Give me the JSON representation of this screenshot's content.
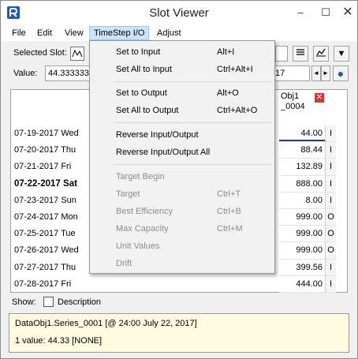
{
  "window": {
    "title": "Slot Viewer",
    "minimize": "–",
    "maximize": "☐",
    "close": "✕"
  },
  "menubar": {
    "items": [
      "File",
      "Edit",
      "View",
      "TimeStep I/O",
      "Adjust"
    ],
    "active_index": 3
  },
  "toolbar": {
    "selected_slot_label": "Selected Slot:",
    "value_label": "Value:",
    "value": "44.333333",
    "date_field": "17",
    "btn_prev": "◄",
    "btn_next": "►",
    "dropdown_arrow": "▼",
    "globe": "●"
  },
  "table": {
    "column_header_line1": "Obj1",
    "column_header_line2": "_0004",
    "close_x": "✕",
    "rows": [
      {
        "date": "07-19-2017 Wed",
        "value": "44.00",
        "flag": "I",
        "bold": false
      },
      {
        "date": "07-20-2017 Thu",
        "value": "88.44",
        "flag": "I",
        "bold": false
      },
      {
        "date": "07-21-2017 Fri",
        "value": "132.89",
        "flag": "I",
        "bold": false
      },
      {
        "date": "07-22-2017 Sat",
        "value": "888.00",
        "flag": "I",
        "bold": true
      },
      {
        "date": "07-23-2017 Sun",
        "value": "8.00",
        "flag": "I",
        "bold": false
      },
      {
        "date": "07-24-2017 Mon",
        "value": "999.00",
        "flag": "O",
        "bold": false
      },
      {
        "date": "07-25-2017 Tue",
        "value": "999.00",
        "flag": "O",
        "bold": false
      },
      {
        "date": "07-26-2017 Wed",
        "value": "999.00",
        "flag": "O",
        "bold": false
      },
      {
        "date": "07-27-2017 Thu",
        "value": "399.56",
        "flag": "I",
        "bold": false
      },
      {
        "date": "07-28-2017 Fri",
        "value": "444.00",
        "flag": "I",
        "bold": false
      }
    ]
  },
  "show": {
    "label": "Show:",
    "description": "Description"
  },
  "info": {
    "line1": "DataObj1.Series_0001 [@ 24:00 July 22, 2017]",
    "line2": "1 value:  44.33 [NONE]"
  },
  "dropdown": {
    "items": [
      {
        "label": "Set to Input",
        "shortcut": "Alt+I",
        "disabled": false
      },
      {
        "label": "Set All to Input",
        "shortcut": "Ctrl+Alt+I",
        "disabled": false
      },
      {
        "label": "Set to Output",
        "shortcut": "Alt+O",
        "disabled": false
      },
      {
        "label": "Set All to Output",
        "shortcut": "Ctrl+Alt+O",
        "disabled": false
      },
      {
        "label": "Reverse Input/Output",
        "shortcut": "",
        "disabled": false
      },
      {
        "label": "Reverse Input/Output All",
        "shortcut": "",
        "disabled": false
      },
      {
        "label": "Target Begin",
        "shortcut": "",
        "disabled": true
      },
      {
        "label": "Target",
        "shortcut": "Ctrl+T",
        "disabled": true
      },
      {
        "label": "Best Efficiency",
        "shortcut": "Ctrl+B",
        "disabled": true
      },
      {
        "label": "Max Capacity",
        "shortcut": "Ctrl+M",
        "disabled": true
      },
      {
        "label": "Unit Values",
        "shortcut": "",
        "disabled": true
      },
      {
        "label": "Drift",
        "shortcut": "",
        "disabled": true
      }
    ]
  },
  "colors": {
    "menu_highlight": "#cce4f7",
    "info_bg": "#fffbe0",
    "selection_line": "#1a3f8f",
    "close_red": "#d33333"
  }
}
